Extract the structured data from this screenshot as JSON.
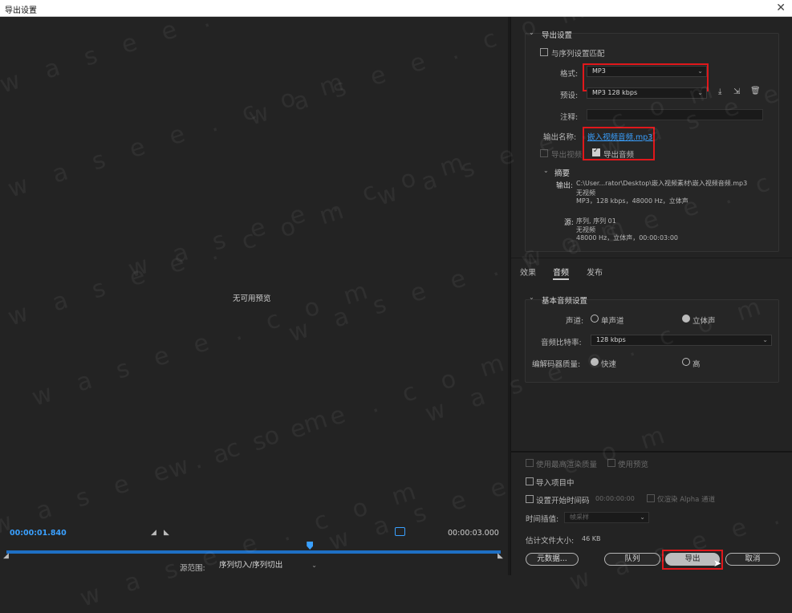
{
  "window": {
    "title": "导出设置",
    "close_glyph": "✕"
  },
  "preview": {
    "empty_text": "无可用预览",
    "time_current": "00:00:01.840",
    "time_total": "00:00:03.000",
    "range_label": "源范围:",
    "range_value": "序列切入/序列切出",
    "playhead_fraction": 0.614
  },
  "export_settings": {
    "section_title": "导出设置",
    "match_sequence_label": "与序列设置匹配",
    "format_label": "格式:",
    "format_value": "MP3",
    "preset_label": "预设:",
    "preset_value": "MP3 128 kbps",
    "comments_label": "注释:",
    "output_name_label": "输出名称:",
    "output_name_value": "嵌入视频音频.mp3",
    "export_video_label": "导出视频",
    "export_audio_label": "导出音频",
    "summary": {
      "title": "摘要",
      "output_label": "输出:",
      "output_lines": [
        "C:\\User...rator\\Desktop\\嵌入视频素材\\嵌入视频音频.mp3",
        "无视频",
        "MP3，128 kbps，48000 Hz，立体声"
      ],
      "source_label": "源:",
      "source_lines": [
        "序列, 序列 01",
        "无视频",
        "48000 Hz，立体声，00:00:03:00"
      ]
    }
  },
  "tabs": [
    {
      "label": "效果"
    },
    {
      "label": "音频"
    },
    {
      "label": "发布"
    }
  ],
  "audio": {
    "section_title": "基本音频设置",
    "channels_label": "声道:",
    "mono_label": "单声道",
    "stereo_label": "立体声",
    "bitrate_label": "音频比特率:",
    "bitrate_value": "128 kbps",
    "quality_label": "编解码器质量:",
    "quality_fast": "快速",
    "quality_high": "高"
  },
  "bottom": {
    "max_render_label": "使用最高渲染质量",
    "use_previews_label": "使用预览",
    "import_project_label": "导入项目中",
    "set_timecode_label": "设置开始时间码",
    "timecode_value": "00:00:00:00",
    "render_alpha_label": "仅渲染 Alpha 通道",
    "interp_label": "时间插值:",
    "interp_value": "帧采样",
    "filesize_label": "估计文件大小:",
    "filesize_value": "46 KB",
    "metadata_btn": "元数据...",
    "queue_btn": "队列",
    "export_btn": "导出",
    "cancel_btn": "取消"
  },
  "watermark": "w a s e e . c o m",
  "colors": {
    "accent_blue": "#2d8ceb",
    "highlight_red": "#e0171b"
  }
}
